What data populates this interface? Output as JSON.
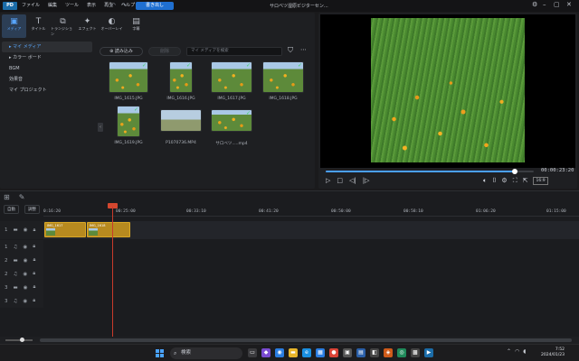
{
  "app": {
    "logo_text": "PD",
    "menus": [
      "ファイル",
      "編集",
      "ツール",
      "表示",
      "再生",
      "ヘルプ"
    ],
    "export_label": "書き出し",
    "project_title": "サロベツ湿原ビジターセン..."
  },
  "tabs": [
    {
      "label": "メディア",
      "icon": "media-icon",
      "glyph": "▣",
      "active": true
    },
    {
      "label": "タイトル",
      "icon": "title-icon",
      "glyph": "T"
    },
    {
      "label": "トランジション",
      "icon": "transition-icon",
      "glyph": "⧉"
    },
    {
      "label": "エフェクト",
      "icon": "effect-icon",
      "glyph": "✦"
    },
    {
      "label": "オーバーレイ",
      "icon": "overlay-icon",
      "glyph": "◐"
    },
    {
      "label": "字幕",
      "icon": "subtitle-icon",
      "glyph": "▤"
    }
  ],
  "sidebar": [
    {
      "label": "マイ メディア",
      "active": true
    },
    {
      "label": "カラー ボード"
    },
    {
      "label": "BGM"
    },
    {
      "label": "効果音"
    },
    {
      "label": "マイ プロジェクト"
    }
  ],
  "library": {
    "import_label": "読み込み",
    "delete_label": "削除",
    "search_placeholder": "マイ メディアを検索",
    "items": [
      {
        "name": "IMG_1615.JPG",
        "kind": "flowers",
        "checked": true
      },
      {
        "name": "IMG_1616.JPG",
        "kind": "flowers",
        "checked": true
      },
      {
        "name": "IMG_1617.JPG",
        "kind": "flowers",
        "checked": true
      },
      {
        "name": "IMG_1618.JPG",
        "kind": "flowers",
        "checked": true
      },
      {
        "name": "IMG_1619.JPG",
        "kind": "flowers",
        "checked": true
      },
      {
        "name": "P1070736.MP4",
        "kind": "field",
        "checked": false
      },
      {
        "name": "サロベツ.....mp4",
        "kind": "flowers",
        "checked": true
      }
    ]
  },
  "preview": {
    "timecode": "00:00:23:20",
    "progress": 0.91,
    "controls": [
      "play-icon",
      "stop-icon",
      "prev-frame-icon",
      "next-frame-icon"
    ],
    "tools": [
      "volume-icon",
      "snapshot-icon",
      "settings-icon",
      "fullscreen-icon",
      "popout-icon",
      "aspect-icon"
    ],
    "aspect_label": "16:9"
  },
  "timeline": {
    "ruler": [
      "0:16:20",
      "00:25:00",
      "00:33:10",
      "00:41:20",
      "00:50:00",
      "00:58:10",
      "01:06:20",
      "01:15:00"
    ],
    "tracks": [
      {
        "num": "1",
        "type": "video"
      },
      {
        "num": "1",
        "type": "audio"
      },
      {
        "num": "2",
        "type": "video"
      },
      {
        "num": "2",
        "type": "audio"
      },
      {
        "num": "3",
        "type": "video"
      },
      {
        "num": "3",
        "type": "audio"
      }
    ],
    "clips": [
      {
        "label": "IMG_1617"
      },
      {
        "label": "IMG_1618"
      }
    ],
    "subtools": [
      "自動",
      "調整"
    ]
  },
  "taskbar": {
    "search_label": "検索",
    "time": "7:52",
    "date": "2024/01/23"
  },
  "colors": {
    "accent": "#1f6fd0",
    "clip": "#b78a1f",
    "playhead": "#c93a2a"
  }
}
